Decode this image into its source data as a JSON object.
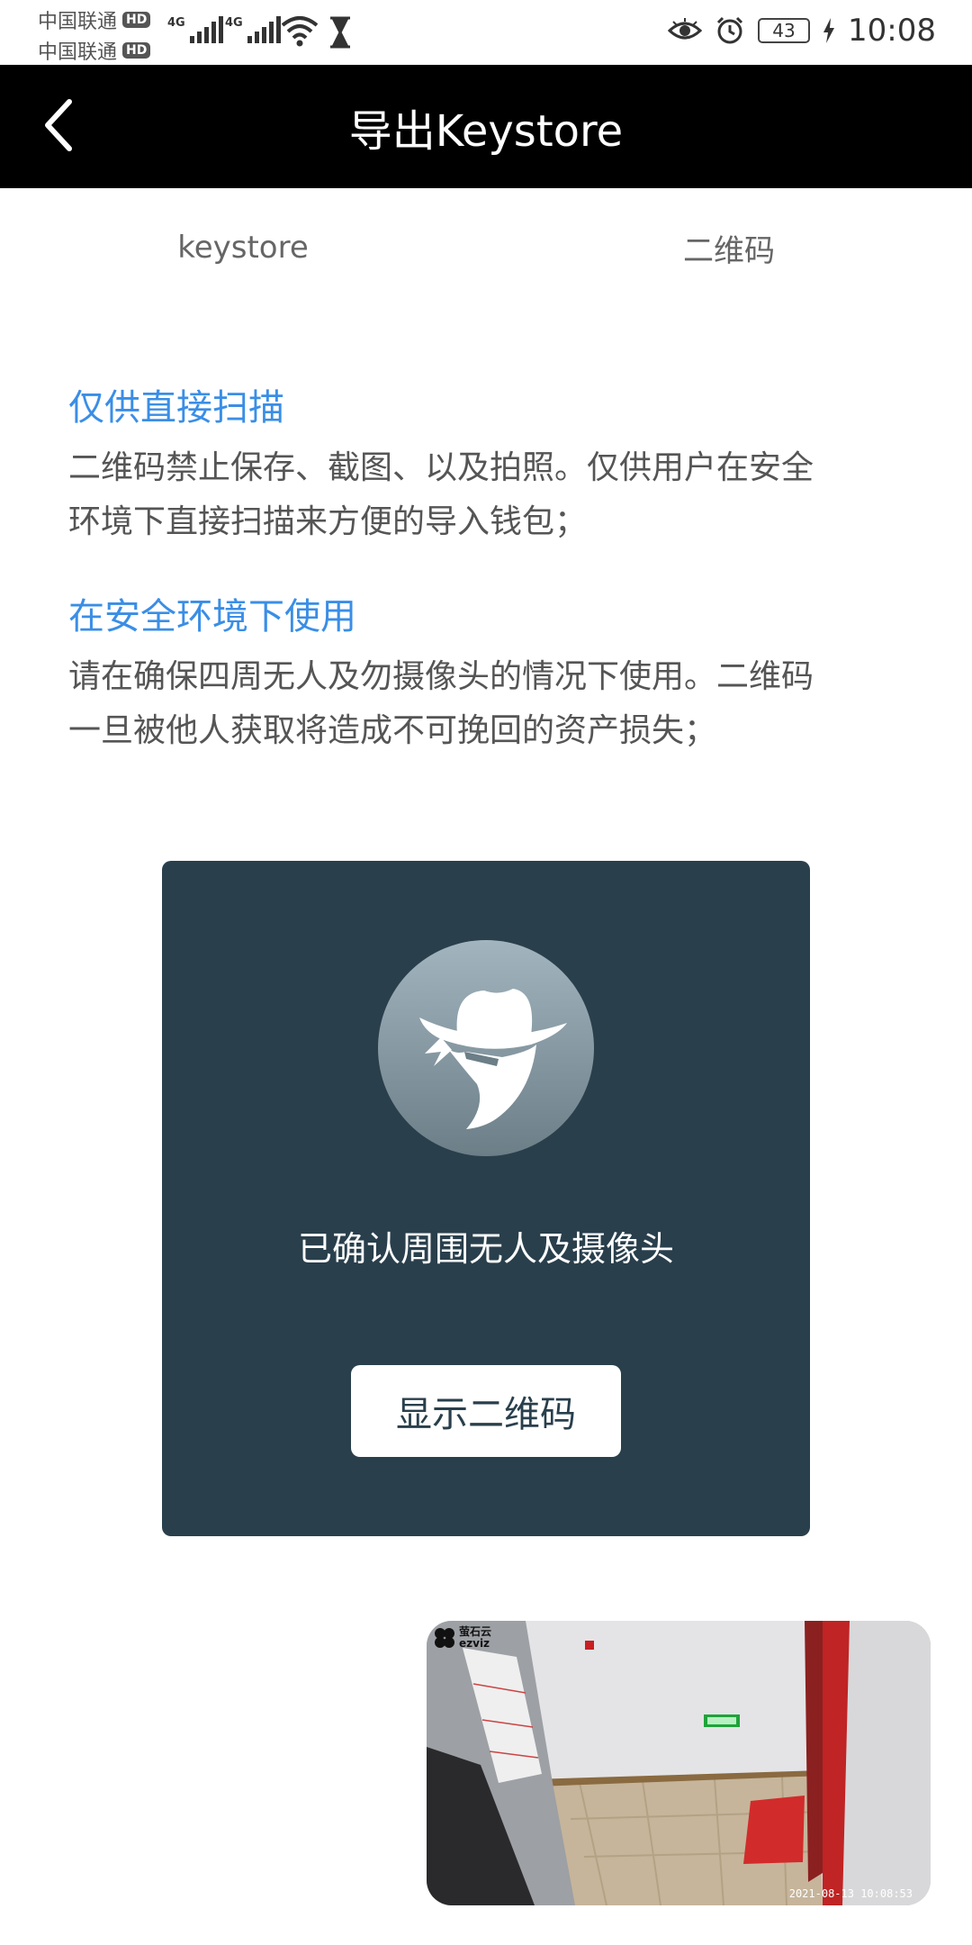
{
  "status_bar": {
    "carrier_1": "中国联通",
    "carrier_2": "中国联通",
    "hd_badge": "HD",
    "network_type": "4G",
    "battery_level": "43",
    "time": "10:08"
  },
  "header": {
    "title": "导出Keystore",
    "back_icon": "chevron-left-icon"
  },
  "tabs": [
    {
      "label": "keystore"
    },
    {
      "label": "二维码"
    }
  ],
  "notices": [
    {
      "title": "仅供直接扫描",
      "lines": [
        "二维码禁止保存、截图、以及拍照。仅供用户在安全",
        "环境下直接扫描来方便的导入钱包；"
      ]
    },
    {
      "title": "在安全环境下使用",
      "lines": [
        "请在确保四周无人及勿摄像头的情况下使用。二维码",
        "一旦被他人获取将造成不可挽回的资产损失；"
      ]
    }
  ],
  "card": {
    "icon": "bandit-hat-icon",
    "confirm_text": "已确认周围无人及摄像头",
    "button_label": "显示二维码"
  },
  "camera_overlay": {
    "brand_line_1": "萤石云",
    "brand_line_2": "ezviz",
    "timestamp": "2021-08-13 10:08:53"
  },
  "colors": {
    "header_bg": "#000000",
    "accent": "#3a8ee6",
    "card_bg": "#293f4c"
  }
}
